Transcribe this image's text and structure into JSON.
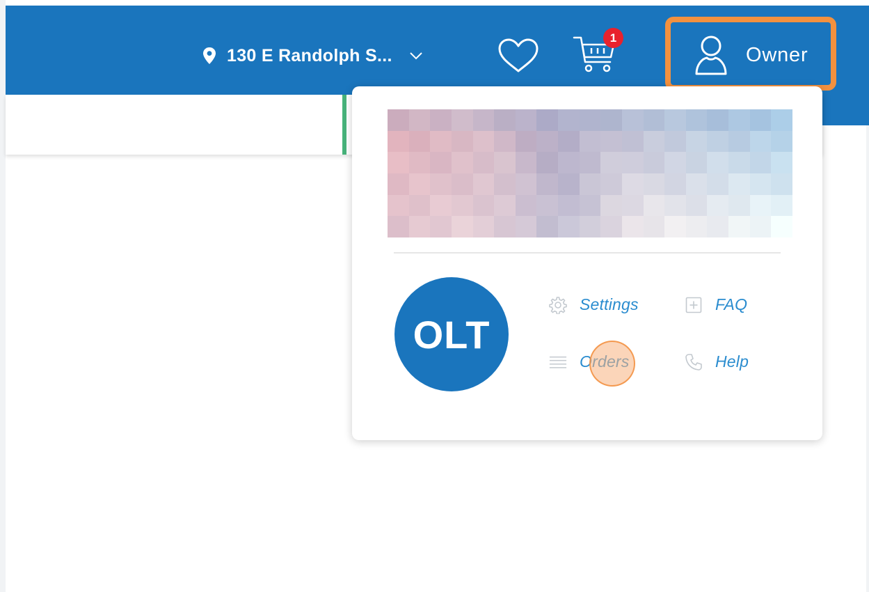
{
  "header": {
    "location_label": "130 E Randolph S...",
    "cart_badge_count": "1",
    "account_label": "Owner"
  },
  "dropdown": {
    "avatar_initials": "OLT",
    "menu": {
      "settings": "Settings",
      "faq": "FAQ",
      "orders": "Orders",
      "help": "Help"
    }
  },
  "colors": {
    "header_blue": "#1a75bd",
    "highlight_orange": "#f3913f",
    "badge_red": "#e8222d",
    "menu_link": "#2a8ccf",
    "accent_green": "#47b27a"
  }
}
